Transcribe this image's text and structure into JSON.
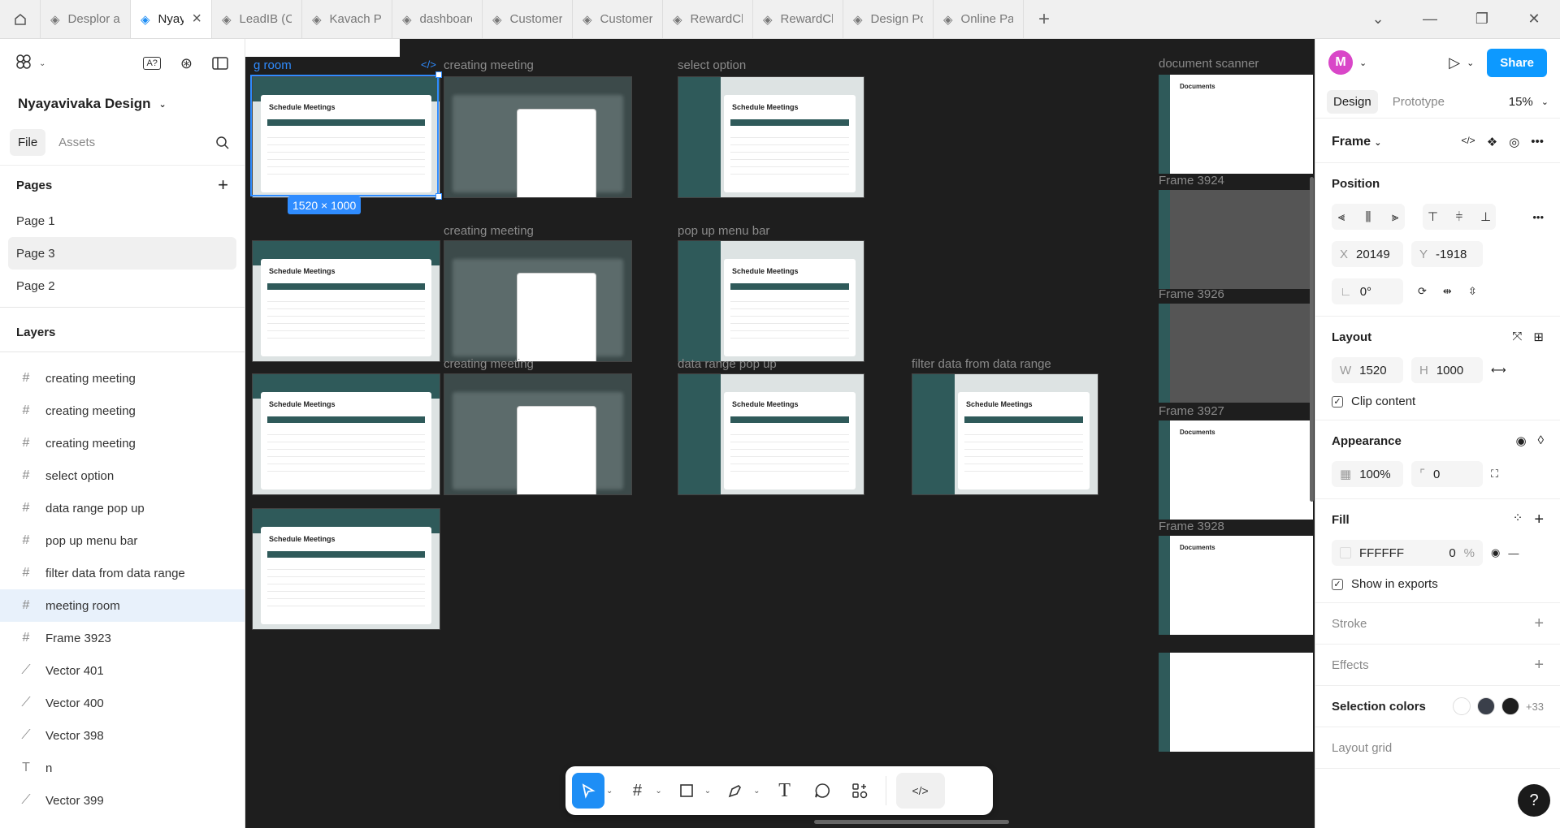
{
  "tabs": [
    {
      "label": "Desplor app"
    },
    {
      "label": "Nyayavivaka",
      "active": true
    },
    {
      "label": "LeadIB (Copy)"
    },
    {
      "label": "Kavach PPt"
    },
    {
      "label": "dashboard-"
    },
    {
      "label": "Customer ic"
    },
    {
      "label": "Customer M"
    },
    {
      "label": "RewardCha"
    },
    {
      "label": "RewardCha"
    },
    {
      "label": "Design Port"
    },
    {
      "label": "Online Paym"
    }
  ],
  "left": {
    "project_name": "Nyayavivaka Design",
    "file_tab": "File",
    "assets_tab": "Assets",
    "pages_heading": "Pages",
    "pages": [
      {
        "label": "Page 1"
      },
      {
        "label": "Page 3",
        "active": true
      },
      {
        "label": "Page 2"
      }
    ],
    "layers_heading": "Layers",
    "layers": [
      {
        "icon": "#",
        "label": "creating meeting"
      },
      {
        "icon": "#",
        "label": "creating meeting"
      },
      {
        "icon": "#",
        "label": "creating meeting"
      },
      {
        "icon": "#",
        "label": "select option"
      },
      {
        "icon": "#",
        "label": "data range pop up"
      },
      {
        "icon": "#",
        "label": "pop up menu bar"
      },
      {
        "icon": "#",
        "label": "filter data from data range"
      },
      {
        "icon": "#",
        "label": "meeting room",
        "active": true
      },
      {
        "icon": "#",
        "label": "Frame 3923"
      },
      {
        "icon": "⟋",
        "label": "Vector 401"
      },
      {
        "icon": "⟋",
        "label": "Vector 400"
      },
      {
        "icon": "⟋",
        "label": "Vector 398"
      },
      {
        "icon": "T",
        "label": "n"
      },
      {
        "icon": "⟋",
        "label": "Vector 399"
      }
    ]
  },
  "canvas": {
    "frame_labels": {
      "meeting_room": "g room",
      "creating_meeting_1": "creating meeting",
      "select_option": "select option",
      "document_scanner": "document scanner",
      "creating_meeting_2": "creating meeting",
      "pop_up_menu_bar": "pop up menu bar",
      "frame_3924": "Frame 3924",
      "frame_3926": "Frame 3926",
      "creating_meeting_3": "creating meeting",
      "data_range_pop_up": "data range pop up",
      "filter_data": "filter data from data range",
      "frame_3927": "Frame 3927",
      "frame_3928": "Frame 3928"
    },
    "frame_title": "Schedule Meetings",
    "documents_title": "Documents",
    "selection_size": "1520 × 1000"
  },
  "right": {
    "avatar_letter": "M",
    "share_label": "Share",
    "design_tab": "Design",
    "prototype_tab": "Prototype",
    "zoom": "15%",
    "frame_type": "Frame",
    "position_heading": "Position",
    "x_label": "X",
    "x_value": "20149",
    "y_label": "Y",
    "y_value": "-1918",
    "rotation": "0°",
    "layout_heading": "Layout",
    "w_label": "W",
    "w_value": "1520",
    "h_label": "H",
    "h_value": "1000",
    "clip_content": "Clip content",
    "appearance_heading": "Appearance",
    "opacity": "100%",
    "radius": "0",
    "fill_heading": "Fill",
    "fill_hex": "FFFFFF",
    "fill_opacity": "0",
    "fill_pct": "%",
    "show_in_exports": "Show in exports",
    "stroke_heading": "Stroke",
    "effects_heading": "Effects",
    "selection_colors_heading": "Selection colors",
    "selection_colors_count": "+33",
    "selection_colors": [
      "#ffffff",
      "#3a3f4a",
      "#1e1e1e"
    ],
    "layout_grid_heading": "Layout grid"
  }
}
